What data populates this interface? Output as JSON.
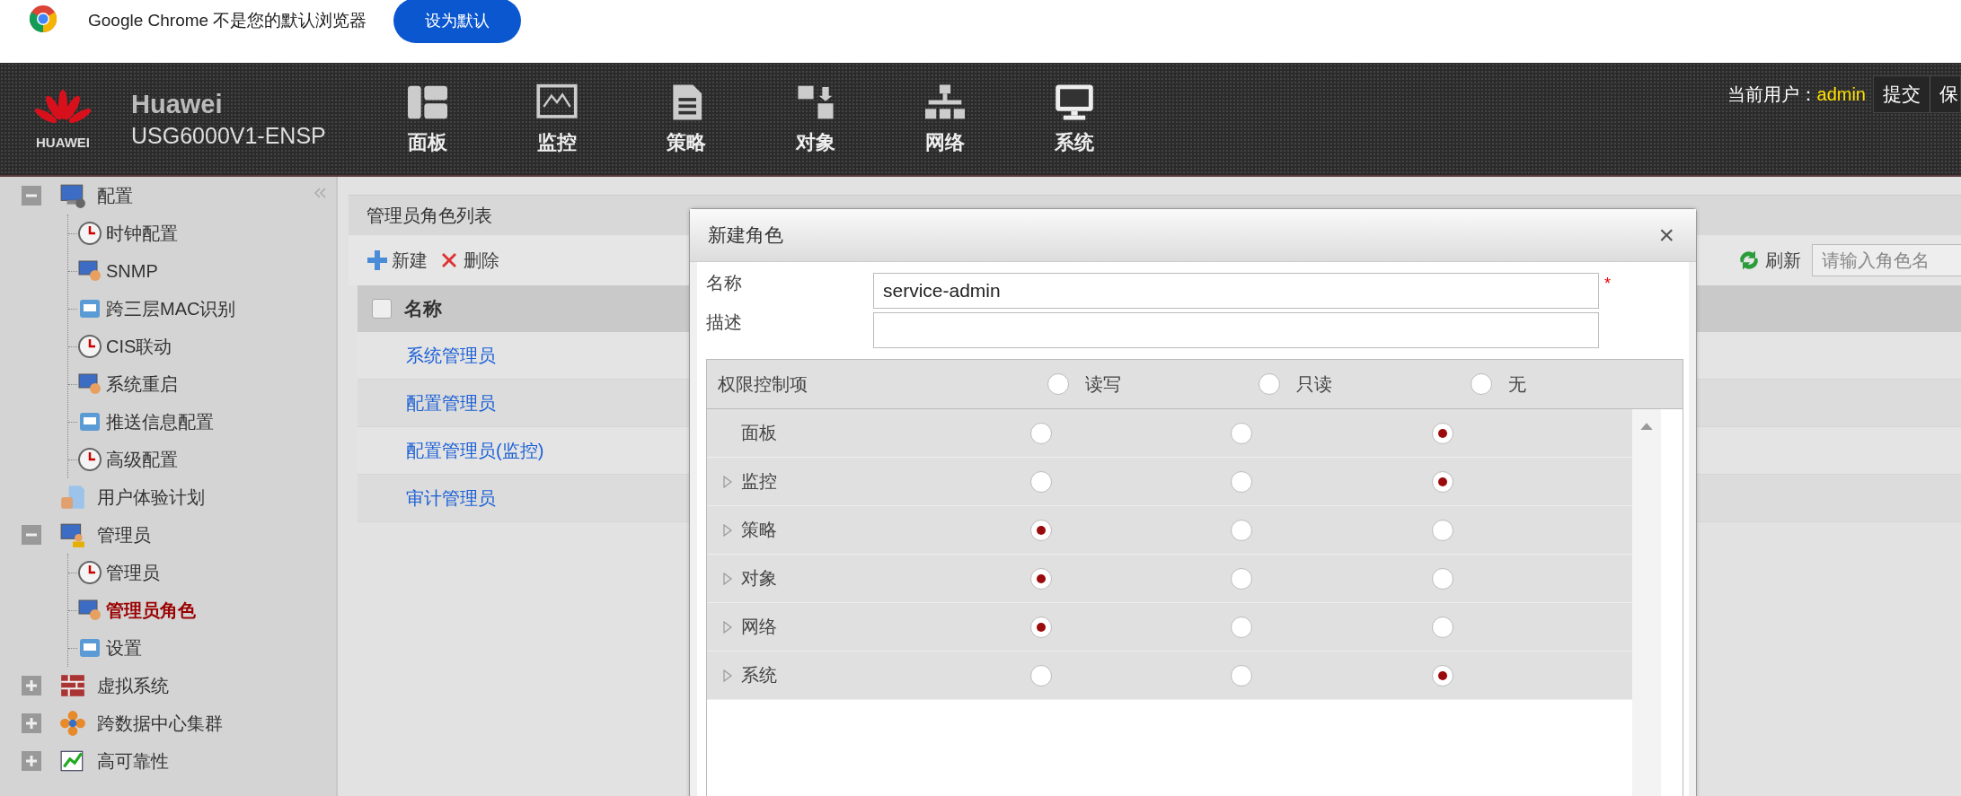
{
  "browser_infobar": {
    "message": "Google Chrome 不是您的默认浏览器",
    "button": "设为默认"
  },
  "header": {
    "brand": "Huawei",
    "logo_text": "HUAWEI",
    "model": "USG6000V1-ENSP",
    "nav": [
      {
        "label": "面板"
      },
      {
        "label": "监控"
      },
      {
        "label": "策略"
      },
      {
        "label": "对象"
      },
      {
        "label": "网络"
      },
      {
        "label": "系统"
      }
    ],
    "user_label": "当前用户：",
    "user": "admin",
    "actions": [
      "提交",
      "保"
    ]
  },
  "sidebar": {
    "items": [
      {
        "label": "配置",
        "expanded": true,
        "selected": false,
        "children": [
          {
            "label": "时钟配置",
            "selected": false
          },
          {
            "label": "SNMP",
            "selected": false
          },
          {
            "label": "跨三层MAC识别",
            "selected": false
          },
          {
            "label": "CIS联动",
            "selected": false
          },
          {
            "label": "系统重启",
            "selected": false
          },
          {
            "label": "推送信息配置",
            "selected": false
          },
          {
            "label": "高级配置",
            "selected": false
          }
        ]
      },
      {
        "label": "用户体验计划",
        "selected": false
      },
      {
        "label": "管理员",
        "expanded": true,
        "selected": false,
        "children": [
          {
            "label": "管理员",
            "selected": false
          },
          {
            "label": "管理员角色",
            "selected": true
          },
          {
            "label": "设置",
            "selected": false
          }
        ]
      },
      {
        "label": "虚拟系统",
        "expanded": false,
        "selected": false
      },
      {
        "label": "跨数据中心集群",
        "expanded": false,
        "selected": false
      },
      {
        "label": "高可靠性",
        "expanded": false,
        "selected": false
      }
    ]
  },
  "panel": {
    "title": "管理员角色列表",
    "toolbar": {
      "add": "新建",
      "delete": "删除",
      "refresh": "刷新",
      "search_placeholder": "请输入角色名"
    },
    "table": {
      "header": "名称",
      "header_checked": false,
      "rows": [
        "系统管理员",
        "配置管理员",
        "配置管理员(监控)",
        "审计管理员"
      ]
    }
  },
  "dialog": {
    "title": "新建角色",
    "close": "×",
    "fields": [
      {
        "label": "名称",
        "value": "service-admin",
        "required": true,
        "required_mark": "*"
      },
      {
        "label": "描述"
      }
    ],
    "permissions": {
      "header": "权限控制项",
      "columns": [
        {
          "label": "读写",
          "selected": false
        },
        {
          "label": "只读",
          "selected": false
        },
        {
          "label": "无",
          "selected": false
        }
      ],
      "rows": [
        {
          "label": "面板",
          "expandable": false,
          "options": [
            {
              "selected": false
            },
            {
              "selected": false
            },
            {
              "selected": true
            }
          ]
        },
        {
          "label": "监控",
          "expandable": true,
          "options": [
            {
              "selected": false
            },
            {
              "selected": false
            },
            {
              "selected": true
            }
          ]
        },
        {
          "label": "策略",
          "expandable": true,
          "options": [
            {
              "selected": true
            },
            {
              "selected": false
            },
            {
              "selected": false
            }
          ]
        },
        {
          "label": "对象",
          "expandable": true,
          "options": [
            {
              "selected": true
            },
            {
              "selected": false
            },
            {
              "selected": false
            }
          ]
        },
        {
          "label": "网络",
          "expandable": true,
          "options": [
            {
              "selected": true
            },
            {
              "selected": false
            },
            {
              "selected": false
            }
          ]
        },
        {
          "label": "系统",
          "expandable": true,
          "options": [
            {
              "selected": false
            },
            {
              "selected": false
            },
            {
              "selected": true
            }
          ]
        }
      ]
    }
  }
}
